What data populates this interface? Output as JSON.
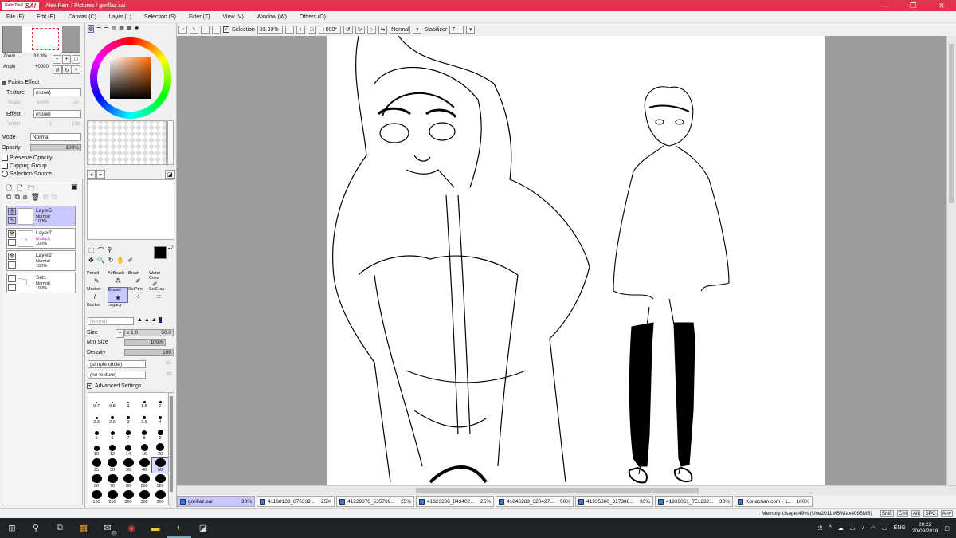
{
  "window": {
    "logo_small": "PaintTool",
    "logo": "SAI",
    "title": "Alex Rem / Pictures / gorillaz.sai",
    "min": "—",
    "max": "❐",
    "close": "✕"
  },
  "menu": [
    "File (F)",
    "Edit (E)",
    "Canvas (C)",
    "Layer (L)",
    "Selection (S)",
    "Filter (T)",
    "View (V)",
    "Window (W)",
    "Others (O)"
  ],
  "toolbar": {
    "selection_label": "Selection",
    "zoom": "33.33%",
    "angle": "+000°",
    "mode": "Normal",
    "stabilizer_label": "Stabilizer",
    "stabilizer_value": "7"
  },
  "navigator": {
    "zoom_label": "Zoom",
    "zoom_value": "33.3%",
    "angle_label": "Angle",
    "angle_value": "+0000"
  },
  "paints_effect": {
    "header": "Paints Effect",
    "texture_label": "Texture",
    "texture_value": "(none)",
    "scale_label": "Scale",
    "scale_value": "100%",
    "scale_num": "20",
    "effect_label": "Effect",
    "effect_value": "(none)",
    "width_label": "Width",
    "width_value": "1",
    "width_num": "100"
  },
  "layer_props": {
    "mode_label": "Mode",
    "mode_value": "Normal",
    "opacity_label": "Opacity",
    "opacity_value": "100%",
    "preserve_opacity": "Preserve Opacity",
    "clipping_group": "Clipping Group",
    "selection_source": "Selection Source"
  },
  "layers": [
    {
      "name": "Layer5",
      "mode": "Normal",
      "opacity": "100%",
      "selected": true
    },
    {
      "name": "Layer7",
      "mode": "Multiply",
      "opacity": "100%",
      "selected": false
    },
    {
      "name": "Layer2",
      "mode": "Normal",
      "opacity": "100%",
      "selected": false
    },
    {
      "name": "Set1",
      "mode": "Normal",
      "opacity": "100%",
      "selected": false
    }
  ],
  "tools": [
    {
      "label": "Pencil",
      "icon": "✎"
    },
    {
      "label": "AirBrush",
      "icon": "⁂"
    },
    {
      "label": "Brush",
      "icon": "✐"
    },
    {
      "label": "Water Color",
      "icon": "✐"
    },
    {
      "label": "Marker",
      "icon": "/"
    },
    {
      "label": "Eraser",
      "icon": "◈"
    },
    {
      "label": "SelPen",
      "icon": "⁘"
    },
    {
      "label": "SelEras",
      "icon": "⁙"
    },
    {
      "label": "Bucket",
      "icon": "/"
    },
    {
      "label": "Legacy",
      "icon": ""
    }
  ],
  "brush": {
    "blend_mode": "Normal",
    "size_label": "Size",
    "size_mult": "x 1.0",
    "size_value": "50.0",
    "min_size_label": "Min Size",
    "min_size_value": "100%",
    "density_label": "Density",
    "density_value": "100",
    "shape": "(simple circle)",
    "shape_num": "50",
    "texture": "(no texture)",
    "texture_num": "95",
    "advanced": "Advanced Settings"
  },
  "brush_sizes": [
    "0.7",
    "0.8",
    "1",
    "1.5",
    "2",
    "2.3",
    "2.6",
    "3",
    "3.5",
    "4",
    "5",
    "6",
    "7",
    "8",
    "9",
    "10",
    "12",
    "14",
    "16",
    "20",
    "25",
    "30",
    "35",
    "40",
    "50",
    "60",
    "70",
    "80",
    "100",
    "120",
    "160",
    "200",
    "250",
    "300",
    "350"
  ],
  "tabs": [
    {
      "name": "gorillaz.sai",
      "pct": "33%",
      "active": true
    },
    {
      "name": "41168133_675339...",
      "pct": "25%",
      "active": false
    },
    {
      "name": "41229876_535739...",
      "pct": "25%",
      "active": false
    },
    {
      "name": "41323206_843402...",
      "pct": "25%",
      "active": false
    },
    {
      "name": "41846283_320427...",
      "pct": "50%",
      "active": false
    },
    {
      "name": "41935300_317388...",
      "pct": "33%",
      "active": false
    },
    {
      "name": "41939061_751232...",
      "pct": "33%",
      "active": false
    },
    {
      "name": "Konachan.com - 1...",
      "pct": "100%",
      "active": false
    }
  ],
  "status": {
    "memory": "Memory Usage:49% (Use2011MB/Max4095MB)",
    "keys": [
      "Shift",
      "Ctrl",
      "Alt",
      "SPC",
      "Any"
    ]
  },
  "taskbar": {
    "lang": "ENG",
    "time": "20:22",
    "date": "20/09/2018",
    "mail_badge": "73"
  },
  "colors": {
    "titlebar": "#e0344e",
    "selected": "#c8c8ff",
    "taskbar": "#1f2326"
  }
}
